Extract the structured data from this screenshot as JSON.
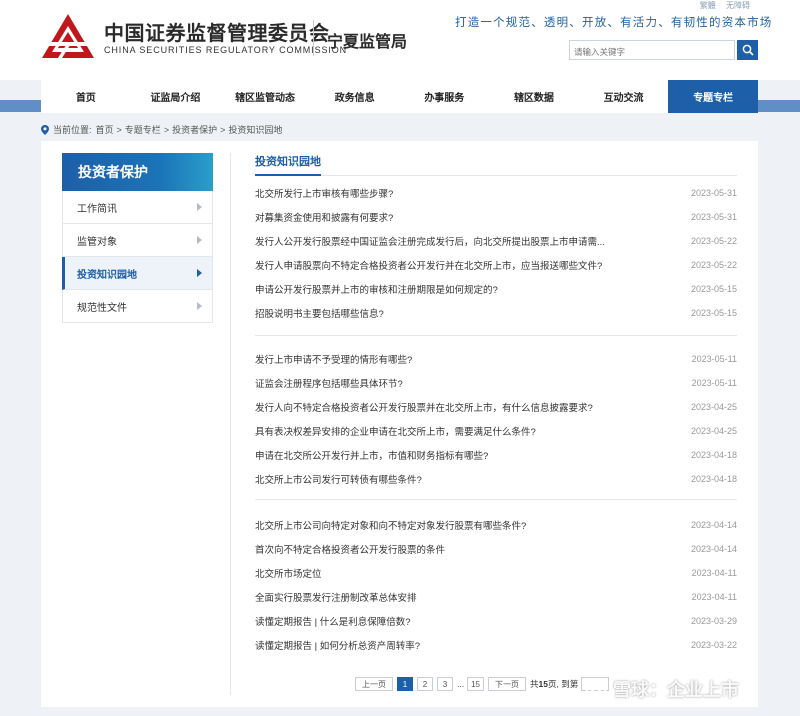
{
  "header": {
    "org_name_cn": "中国证券监督管理委员会",
    "org_name_en": "CHINA SECURITIES REGULATORY COMMISSION",
    "bureau": "宁夏监管局",
    "slogan": "打造一个规范、透明、开放、有活力、有韧性的资本市场",
    "toplinks": [
      "繁體",
      "无障碍"
    ],
    "search_placeholder": "请输入关键字",
    "brand_color": "#1d5fa8",
    "logo_color": "#c0171d"
  },
  "nav": {
    "items": [
      "首页",
      "证监局介绍",
      "辖区监管动态",
      "政务信息",
      "办事服务",
      "辖区数据",
      "互动交流",
      "专题专栏"
    ],
    "active_index": 7
  },
  "breadcrumb": {
    "prefix": "当前位置:",
    "items": [
      "首页",
      "专题专栏",
      "投资者保护",
      "投资知识园地"
    ],
    "separator": ">"
  },
  "sidebar": {
    "title": "投资者保护",
    "items": [
      "工作简讯",
      "监管对象",
      "投资知识园地",
      "规范性文件"
    ],
    "active_index": 2
  },
  "content": {
    "title": "投资知识园地",
    "groups": [
      [
        {
          "title": "北交所发行上市审核有哪些步骤?",
          "date": "2023-05-31"
        },
        {
          "title": "对募集资金使用和披露有何要求?",
          "date": "2023-05-31"
        },
        {
          "title": "发行人公开发行股票经中国证监会注册完成发行后，向北交所提出股票上市申请需...",
          "date": "2023-05-22"
        },
        {
          "title": "发行人申请股票向不特定合格投资者公开发行并在北交所上市，应当报送哪些文件?",
          "date": "2023-05-22"
        },
        {
          "title": "申请公开发行股票并上市的审核和注册期限是如何规定的?",
          "date": "2023-05-15"
        },
        {
          "title": "招股说明书主要包括哪些信息?",
          "date": "2023-05-15"
        }
      ],
      [
        {
          "title": "发行上市申请不予受理的情形有哪些?",
          "date": "2023-05-11"
        },
        {
          "title": "证监会注册程序包括哪些具体环节?",
          "date": "2023-05-11"
        },
        {
          "title": "发行人向不特定合格投资者公开发行股票并在北交所上市，有什么信息披露要求?",
          "date": "2023-04-25"
        },
        {
          "title": "具有表决权差异安排的企业申请在北交所上市，需要满足什么条件?",
          "date": "2023-04-25"
        },
        {
          "title": "申请在北交所公开发行并上市，市值和财务指标有哪些?",
          "date": "2023-04-18"
        },
        {
          "title": "北交所上市公司发行可转债有哪些条件?",
          "date": "2023-04-18"
        }
      ],
      [
        {
          "title": "北交所上市公司向特定对象和向不特定对象发行股票有哪些条件?",
          "date": "2023-04-14"
        },
        {
          "title": "首次向不特定合格投资者公开发行股票的条件",
          "date": "2023-04-14"
        },
        {
          "title": "北交所市场定位",
          "date": "2023-04-11"
        },
        {
          "title": "全面实行股票发行注册制改革总体安排",
          "date": "2023-04-11"
        },
        {
          "title": "读懂定期报告 | 什么是利息保障倍数?",
          "date": "2023-03-29"
        },
        {
          "title": "读懂定期报告 | 如何分析总资产周转率?",
          "date": "2023-03-22"
        }
      ]
    ]
  },
  "pagination": {
    "prev": "上一页",
    "pages": [
      "1",
      "2",
      "3"
    ],
    "ellipsis": "...",
    "last": "15",
    "next": "下一页",
    "total_prefix": "共",
    "total_pages": "15",
    "total_suffix": "页, 到第",
    "current": "1"
  },
  "watermark": {
    "text": "雪球：企业上市"
  }
}
